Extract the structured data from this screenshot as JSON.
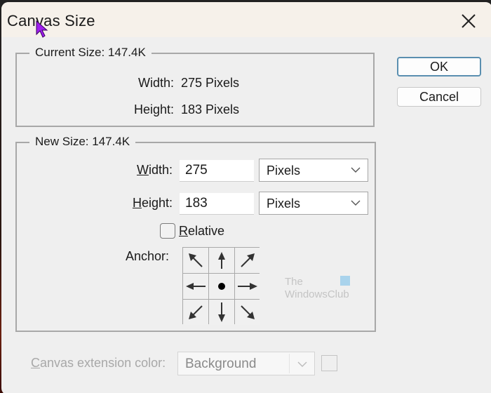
{
  "dialog": {
    "title": "Canvas Size",
    "close_icon": "close-icon"
  },
  "buttons": {
    "ok": "OK",
    "cancel": "Cancel"
  },
  "current_size": {
    "legend": "Current Size: 147.4K",
    "width_label": "Width:",
    "width_value": "275 Pixels",
    "height_label": "Height:",
    "height_value": "183 Pixels"
  },
  "new_size": {
    "legend": "New Size: 147.4K",
    "width_label_ul": "W",
    "width_label_rest": "idth:",
    "width_value": "275",
    "width_unit": "Pixels",
    "height_label_ul": "H",
    "height_label_rest": "eight:",
    "height_value": "183",
    "height_unit": "Pixels",
    "relative_ul": "R",
    "relative_rest": "elative",
    "relative_checked": false,
    "anchor_label": "Anchor:",
    "anchor_selected": "center",
    "anchor_cells": [
      {
        "pos": "top-left",
        "icon": "arrow-up-left-icon"
      },
      {
        "pos": "top",
        "icon": "arrow-up-icon"
      },
      {
        "pos": "top-right",
        "icon": "arrow-up-right-icon"
      },
      {
        "pos": "left",
        "icon": "arrow-left-icon"
      },
      {
        "pos": "center",
        "icon": "dot-icon"
      },
      {
        "pos": "right",
        "icon": "arrow-right-icon"
      },
      {
        "pos": "bottom-left",
        "icon": "arrow-down-left-icon"
      },
      {
        "pos": "bottom",
        "icon": "arrow-down-icon"
      },
      {
        "pos": "bottom-right",
        "icon": "arrow-down-right-icon"
      }
    ]
  },
  "extension": {
    "label_ul": "C",
    "label_rest": "anvas extension color:",
    "value": "Background",
    "disabled": true
  },
  "watermark": {
    "line1": "The",
    "line2": "WindowsClub"
  },
  "colors": {
    "ok_border": "#5a8fb0",
    "cursor": "#a020f0",
    "dialog_bg": "#efefef",
    "titlebar_bg": "#f6f1ea"
  }
}
